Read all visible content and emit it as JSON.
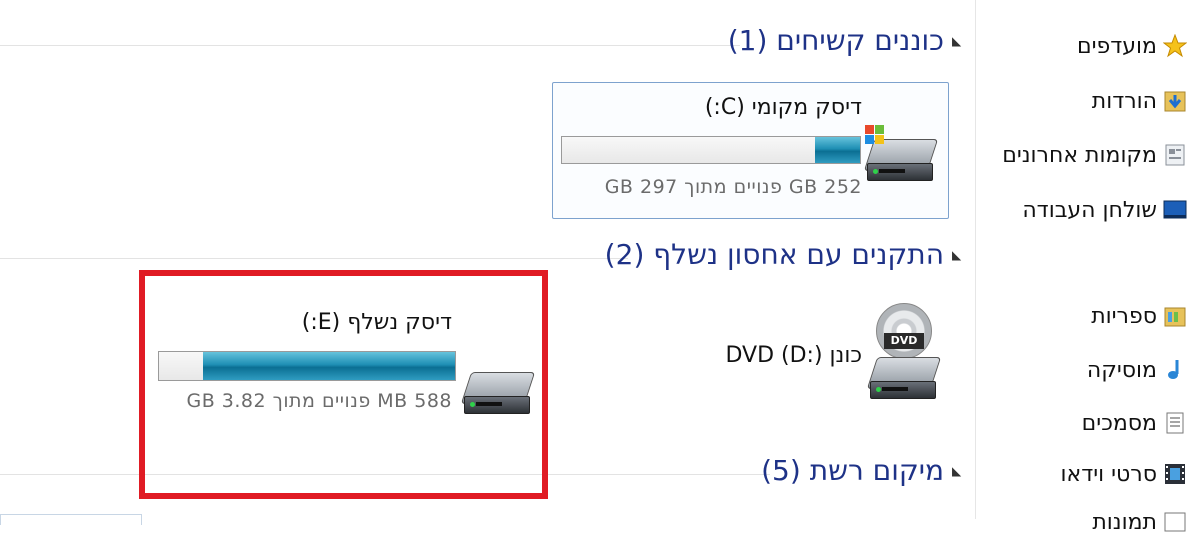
{
  "nav": {
    "favorites": [
      {
        "label": "מועדפים",
        "icon": "star-icon"
      },
      {
        "label": "הורדות",
        "icon": "downloads-icon"
      },
      {
        "label": "מקומות אחרונים",
        "icon": "recent-places-icon"
      },
      {
        "label": "שולחן העבודה",
        "icon": "desktop-icon"
      }
    ],
    "libraries": [
      {
        "label": "ספריות",
        "icon": "libraries-icon"
      },
      {
        "label": "מוסיקה",
        "icon": "music-icon"
      },
      {
        "label": "מסמכים",
        "icon": "documents-icon"
      },
      {
        "label": "סרטי וידאו",
        "icon": "videos-icon"
      },
      {
        "label": "תמונות",
        "icon": "pictures-icon"
      }
    ]
  },
  "groups": {
    "hard_disks": "כוננים קשיחים (1)",
    "removable": "התקנים עם אחסון נשלף (2)",
    "network": "מיקום רשת (5)"
  },
  "drives": {
    "c": {
      "title": "דיסק מקומי (C:)",
      "info": "252 GB פנויים מתוך 297 GB",
      "used_fraction": 0.15
    },
    "e": {
      "title": "דיסק נשלף (E:)",
      "info": "588 MB פנויים מתוך 3.82 GB",
      "used_fraction": 0.85
    },
    "d": {
      "title": "כונן DVD (D:)",
      "label": "DVD"
    }
  },
  "colors": {
    "accent": "#1e3287",
    "highlight": "#e01b24",
    "bar_fill": "#1f8fb4"
  }
}
